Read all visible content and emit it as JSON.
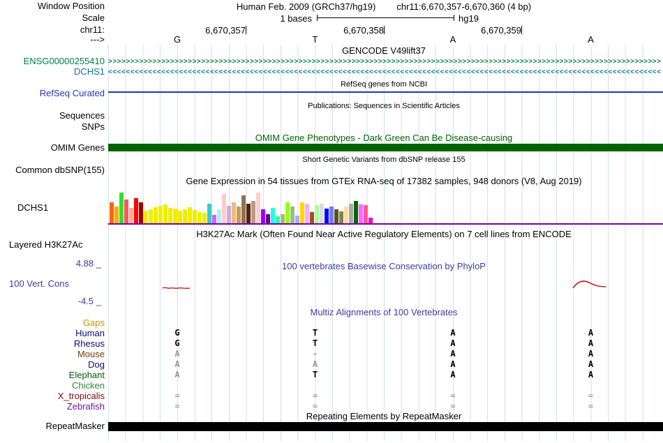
{
  "meta": {
    "window_position_label": "Window Position",
    "assembly_text": "Human Feb. 2009 (GRCh37/hg19)",
    "position_text": "chr11:6,670,357-6,670,360 (4 bp)",
    "scale_label": "Scale",
    "scale_value": "1 bases",
    "assembly_tag": "hg19",
    "chrom_label": "chr11:",
    "strand_label": "--->",
    "coordinates": [
      "6,670,357",
      "6,670,358",
      "6,670,359"
    ],
    "bases": [
      "G",
      "T",
      "A",
      "A"
    ]
  },
  "tracks": {
    "gencode": {
      "header": "GENCODE V49lift37",
      "items": [
        {
          "label": "ENSG00000255410",
          "strand": ">",
          "color": "#008040"
        },
        {
          "label": "DCHS1",
          "strand": "<",
          "color": "#087890"
        }
      ]
    },
    "refseq": {
      "header": "RefSeq genes from NCBI",
      "label": "RefSeq Curated",
      "color": "#2233BB"
    },
    "publications": {
      "header": "Publications: Sequences in Scientific Articles",
      "items": [
        "Sequences",
        "SNPs"
      ]
    },
    "omim": {
      "header": "OMIM Gene Phenotypes - Dark Green Can Be Disease-causing",
      "label": "OMIM Genes",
      "color": "#006400"
    },
    "dbsnp": {
      "header": "Short Genetic Variants from dbSNP release 155",
      "label": "Common dbSNP(155)"
    },
    "gtex": {
      "header": "Gene Expression in 54 tissues from GTEx RNA-seq of 17382 samples, 948 donors (V8, Aug 2019)",
      "label": "DCHS1",
      "baseline_color": "#7700AA"
    },
    "h3k27ac": {
      "header": "H3K27Ac Mark (Often Found Near Active Regulatory Elements) on 7 cell lines from ENCODE",
      "label": "Layered H3K27Ac"
    },
    "phylop": {
      "header": "100 vertebrates Basewise Conservation by PhyloP",
      "label": "100 Vert. Cons",
      "max_label": "4.88 _",
      "min_label": "-4.5 _",
      "header_color": "#3C3CA0",
      "signal_color": "#CC0000"
    },
    "multiz": {
      "header": "Multiz Alignments of 100 Vertebrates",
      "header_color": "#3C3CA0",
      "rows": [
        {
          "name": "Gaps",
          "label_color": "#C49406",
          "cells": [
            "",
            "",
            "",
            ""
          ],
          "dim": [
            false,
            false,
            false,
            false
          ]
        },
        {
          "name": "Human",
          "label_color": "#0B0B6F",
          "cells": [
            "G",
            "T",
            "A",
            "A"
          ],
          "dim": [
            false,
            false,
            false,
            false
          ]
        },
        {
          "name": "Rhesus",
          "label_color": "#0B0B6F",
          "cells": [
            "G",
            "T",
            "A",
            "A"
          ],
          "dim": [
            false,
            false,
            false,
            false
          ]
        },
        {
          "name": "Mouse",
          "label_color": "#7A3B06",
          "cells": [
            "A",
            "-",
            "A",
            "A"
          ],
          "dim": [
            true,
            true,
            false,
            false
          ]
        },
        {
          "name": "Dog",
          "label_color": "#0B0B6F",
          "cells": [
            "A",
            "A",
            "A",
            "A"
          ],
          "dim": [
            true,
            true,
            false,
            false
          ]
        },
        {
          "name": "Elephant",
          "label_color": "#0B5A0B",
          "cells": [
            "A",
            "T",
            "A",
            "A"
          ],
          "dim": [
            true,
            false,
            false,
            false
          ]
        },
        {
          "name": "Chicken",
          "label_color": "#2E8B2E",
          "cells": [
            "",
            "",
            "",
            ""
          ],
          "dim": [
            false,
            false,
            false,
            false
          ]
        },
        {
          "name": "X_tropicalis",
          "label_color": "#7A0B0B",
          "cells": [
            "=",
            "=",
            "=",
            "="
          ],
          "dim": [
            true,
            true,
            true,
            true
          ]
        },
        {
          "name": "Zebrafish",
          "label_color": "#6A1B9A",
          "cells": [
            "=",
            "=",
            "=",
            "="
          ],
          "dim": [
            true,
            true,
            true,
            true
          ]
        }
      ]
    },
    "repeatmasker": {
      "header": "Repeating Elements by RepeatMasker",
      "label": "RepeatMasker",
      "color": "#000000"
    }
  },
  "chart_data": {
    "type": "bar",
    "title": "Gene Expression in 54 tissues from GTEx RNA-seq of 17382 samples, 948 donors (V8, Aug 2019)",
    "gene": "DCHS1",
    "n_tissues": 54,
    "ylabel": "expression (unlabeled axis, bar heights in px est.)",
    "colors": [
      "#FF6600",
      "#FFAA00",
      "#33DD33",
      "#FF5555",
      "#FFAA99",
      "#FF0000",
      "#AA0000",
      "#EEEE00",
      "#EEEE00",
      "#EEEE00",
      "#EEEE00",
      "#EEEE00",
      "#EEEE00",
      "#EEEE00",
      "#EEEE00",
      "#EEEE00",
      "#EEEE00",
      "#EEEE00",
      "#EEEE00",
      "#EEEE00",
      "#33CCCC",
      "#CC66FF",
      "#AAEEFF",
      "#FFCCCC",
      "#CCAADD",
      "#EEBB77",
      "#CC9955",
      "#8B7355",
      "#552200",
      "#BB9988",
      "#FFCCCC",
      "#9900FF",
      "#660099",
      "#22FFDD",
      "#2AF5C0",
      "#AABB66",
      "#99FF00",
      "#99BB88",
      "#AAAAFF",
      "#FFD700",
      "#FFAAFF",
      "#995522",
      "#AAFF99",
      "#DDDDDD",
      "#0000FF",
      "#7777FF",
      "#555522",
      "#778855",
      "#FFDD99",
      "#AAAAAA",
      "#006600",
      "#FF66FF",
      "#FF5599",
      "#FF00BB"
    ],
    "values": [
      30,
      24,
      44,
      34,
      22,
      36,
      30,
      18,
      20,
      23,
      25,
      27,
      22,
      21,
      18,
      20,
      23,
      19,
      16,
      15,
      28,
      12,
      20,
      42,
      25,
      30,
      24,
      40,
      28,
      32,
      44,
      20,
      13,
      22,
      10,
      13,
      30,
      24,
      11,
      30,
      28,
      16,
      26,
      28,
      21,
      24,
      20,
      17,
      24,
      28,
      32,
      27,
      26,
      8
    ]
  }
}
